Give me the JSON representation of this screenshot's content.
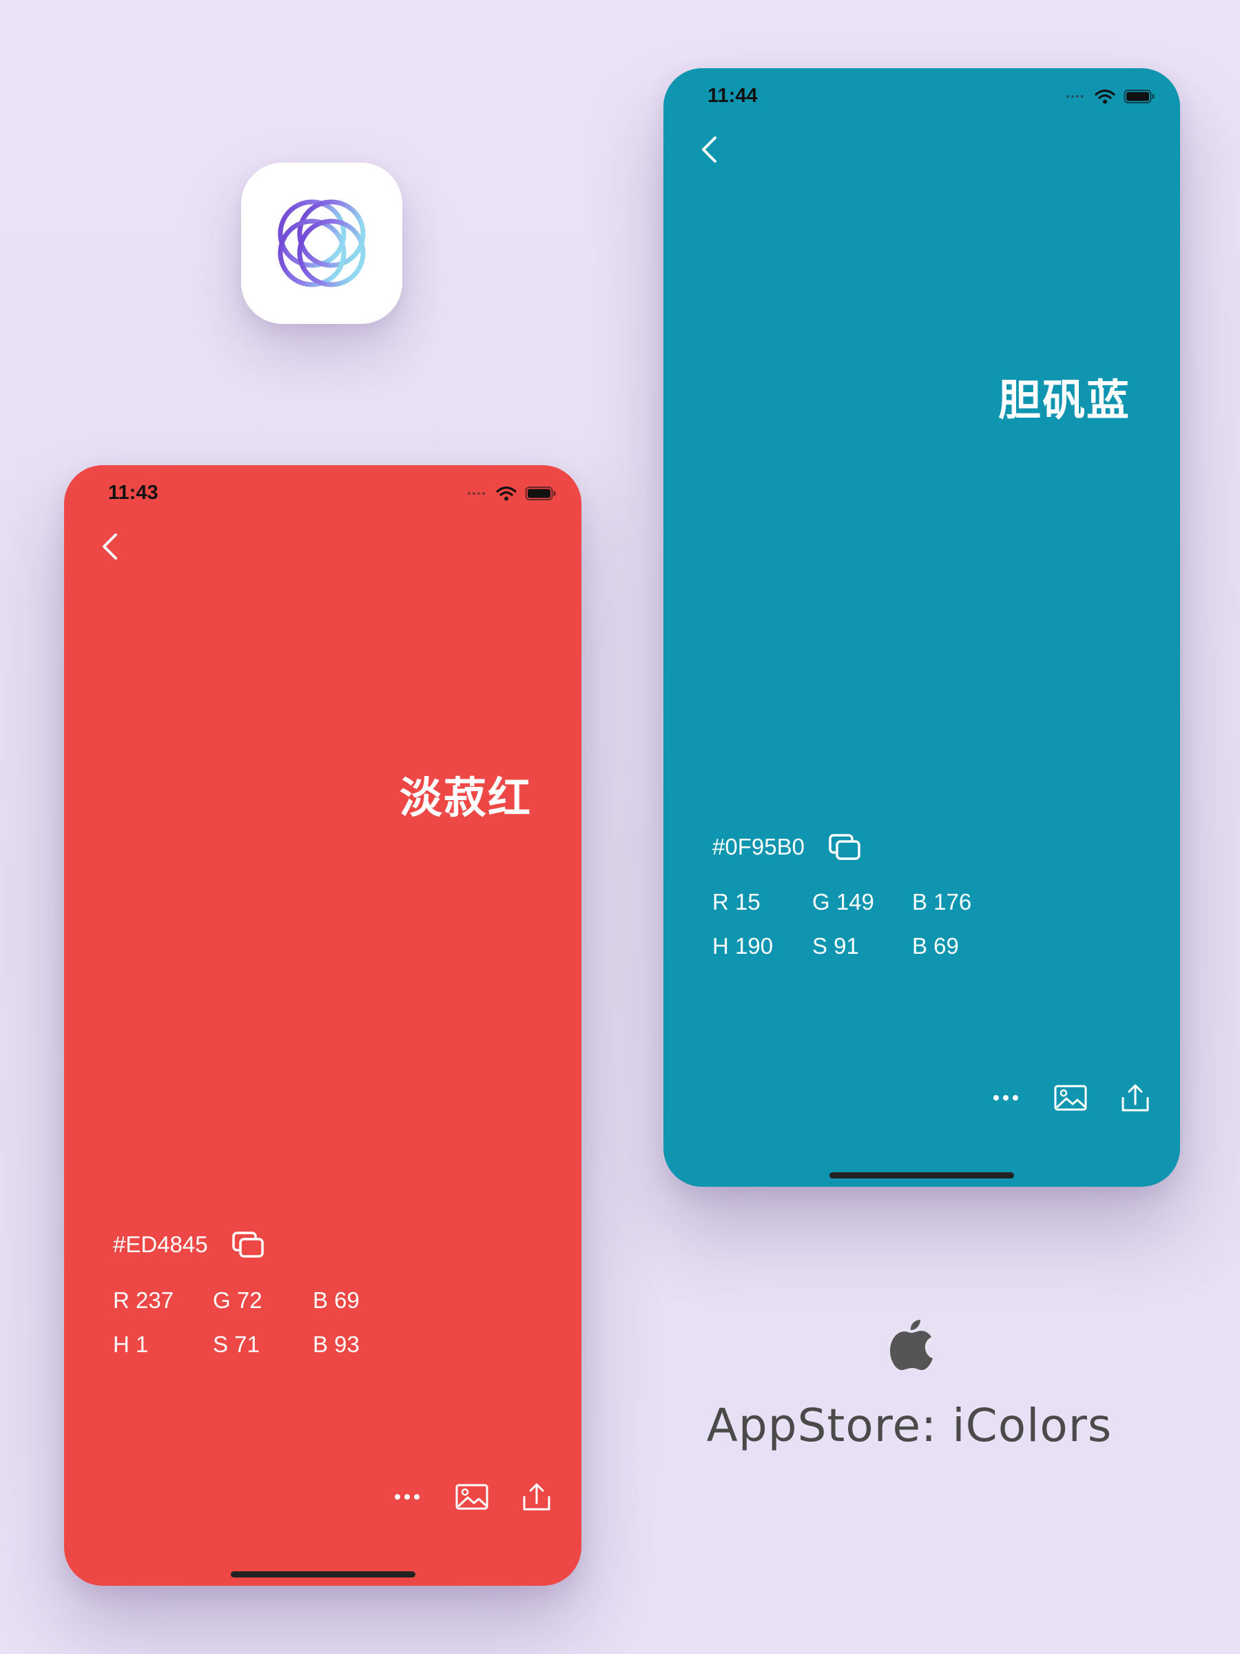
{
  "colors": {
    "background": "#E9E2F4",
    "red": "#ED4845",
    "blue": "#0F95B0"
  },
  "app_icon": {
    "icon": "overlapping-rings-logo"
  },
  "screens": [
    {
      "status_time": "11:43",
      "color_name": "淡菽红",
      "hex": "#ED4845",
      "rgb": {
        "r": "R 237",
        "g": "G 72",
        "b": "B 69"
      },
      "hsb": {
        "h": "H 1",
        "s": "S 71",
        "b": "B 93"
      }
    },
    {
      "status_time": "11:44",
      "color_name": "胆矾蓝",
      "hex": "#0F95B0",
      "rgb": {
        "r": "R 15",
        "g": "G 149",
        "b": "B 176"
      },
      "hsb": {
        "h": "H 190",
        "s": "S 91",
        "b": "B 69"
      }
    }
  ],
  "store": {
    "icon": "apple-logo",
    "label": "AppStore: iColors"
  }
}
